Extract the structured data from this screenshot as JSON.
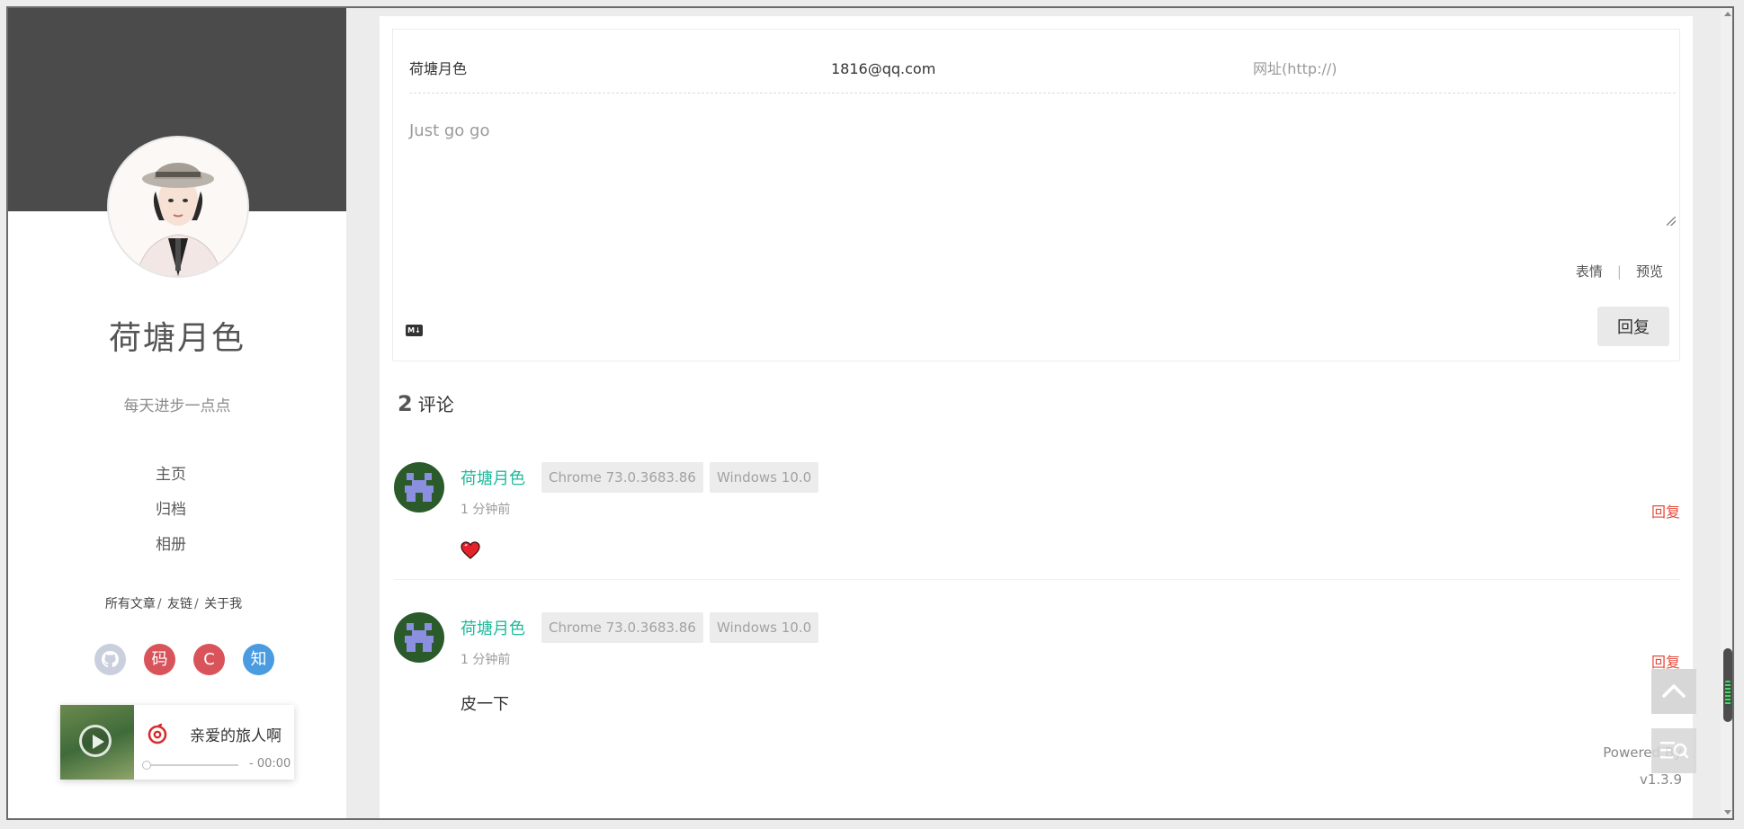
{
  "sidebar": {
    "site_name": "荷塘月色",
    "description": "每天进步一点点",
    "nav": [
      {
        "label": "主页"
      },
      {
        "label": "归档"
      },
      {
        "label": "相册"
      }
    ],
    "links": [
      {
        "label": "所有文章"
      },
      {
        "label": "友链"
      },
      {
        "label": "关于我"
      }
    ],
    "link_separator": "/",
    "socials": [
      {
        "icon": "github-icon",
        "glyph": "",
        "color": "#c9cfdc"
      },
      {
        "icon": "gitee-icon",
        "glyph": "码",
        "color": "#d9535a"
      },
      {
        "icon": "csdn-icon",
        "glyph": "C",
        "color": "#d9535a"
      },
      {
        "icon": "zhihu-icon",
        "glyph": "知",
        "color": "#4a9be0"
      }
    ]
  },
  "player": {
    "song_title": "亲爱的旅人啊",
    "time": "- 00:00",
    "progress": 0,
    "brand_color": "#d92b2b"
  },
  "comment_form": {
    "nickname_value": "荷塘月色",
    "email_value": "1816@qq.com",
    "url_placeholder": "网址(http://)",
    "content_placeholder": "Just go go",
    "emoji_label": "表情",
    "separator": "|",
    "preview_label": "预览",
    "markdown_icon": "M↓",
    "submit_label": "回复"
  },
  "comments_header": {
    "count": "2",
    "label": "评论"
  },
  "comments": [
    {
      "author": "荷塘月色",
      "browser": "Chrome 73.0.3683.86",
      "os": "Windows 10.0",
      "time": "1 分钟前",
      "reply_label": "回复",
      "body": "",
      "body_icon": "heart-emoji-icon"
    },
    {
      "author": "荷塘月色",
      "browser": "Chrome 73.0.3683.86",
      "os": "Windows 10.0",
      "time": "1 分钟前",
      "reply_label": "回复",
      "body": "皮一下"
    }
  ],
  "footer": {
    "powered_by": "Powered By",
    "version": "v1.3.9"
  },
  "colors": {
    "accent": "#1dba9c",
    "reply": "#e64b3b",
    "cover": "#4b4b4b"
  }
}
